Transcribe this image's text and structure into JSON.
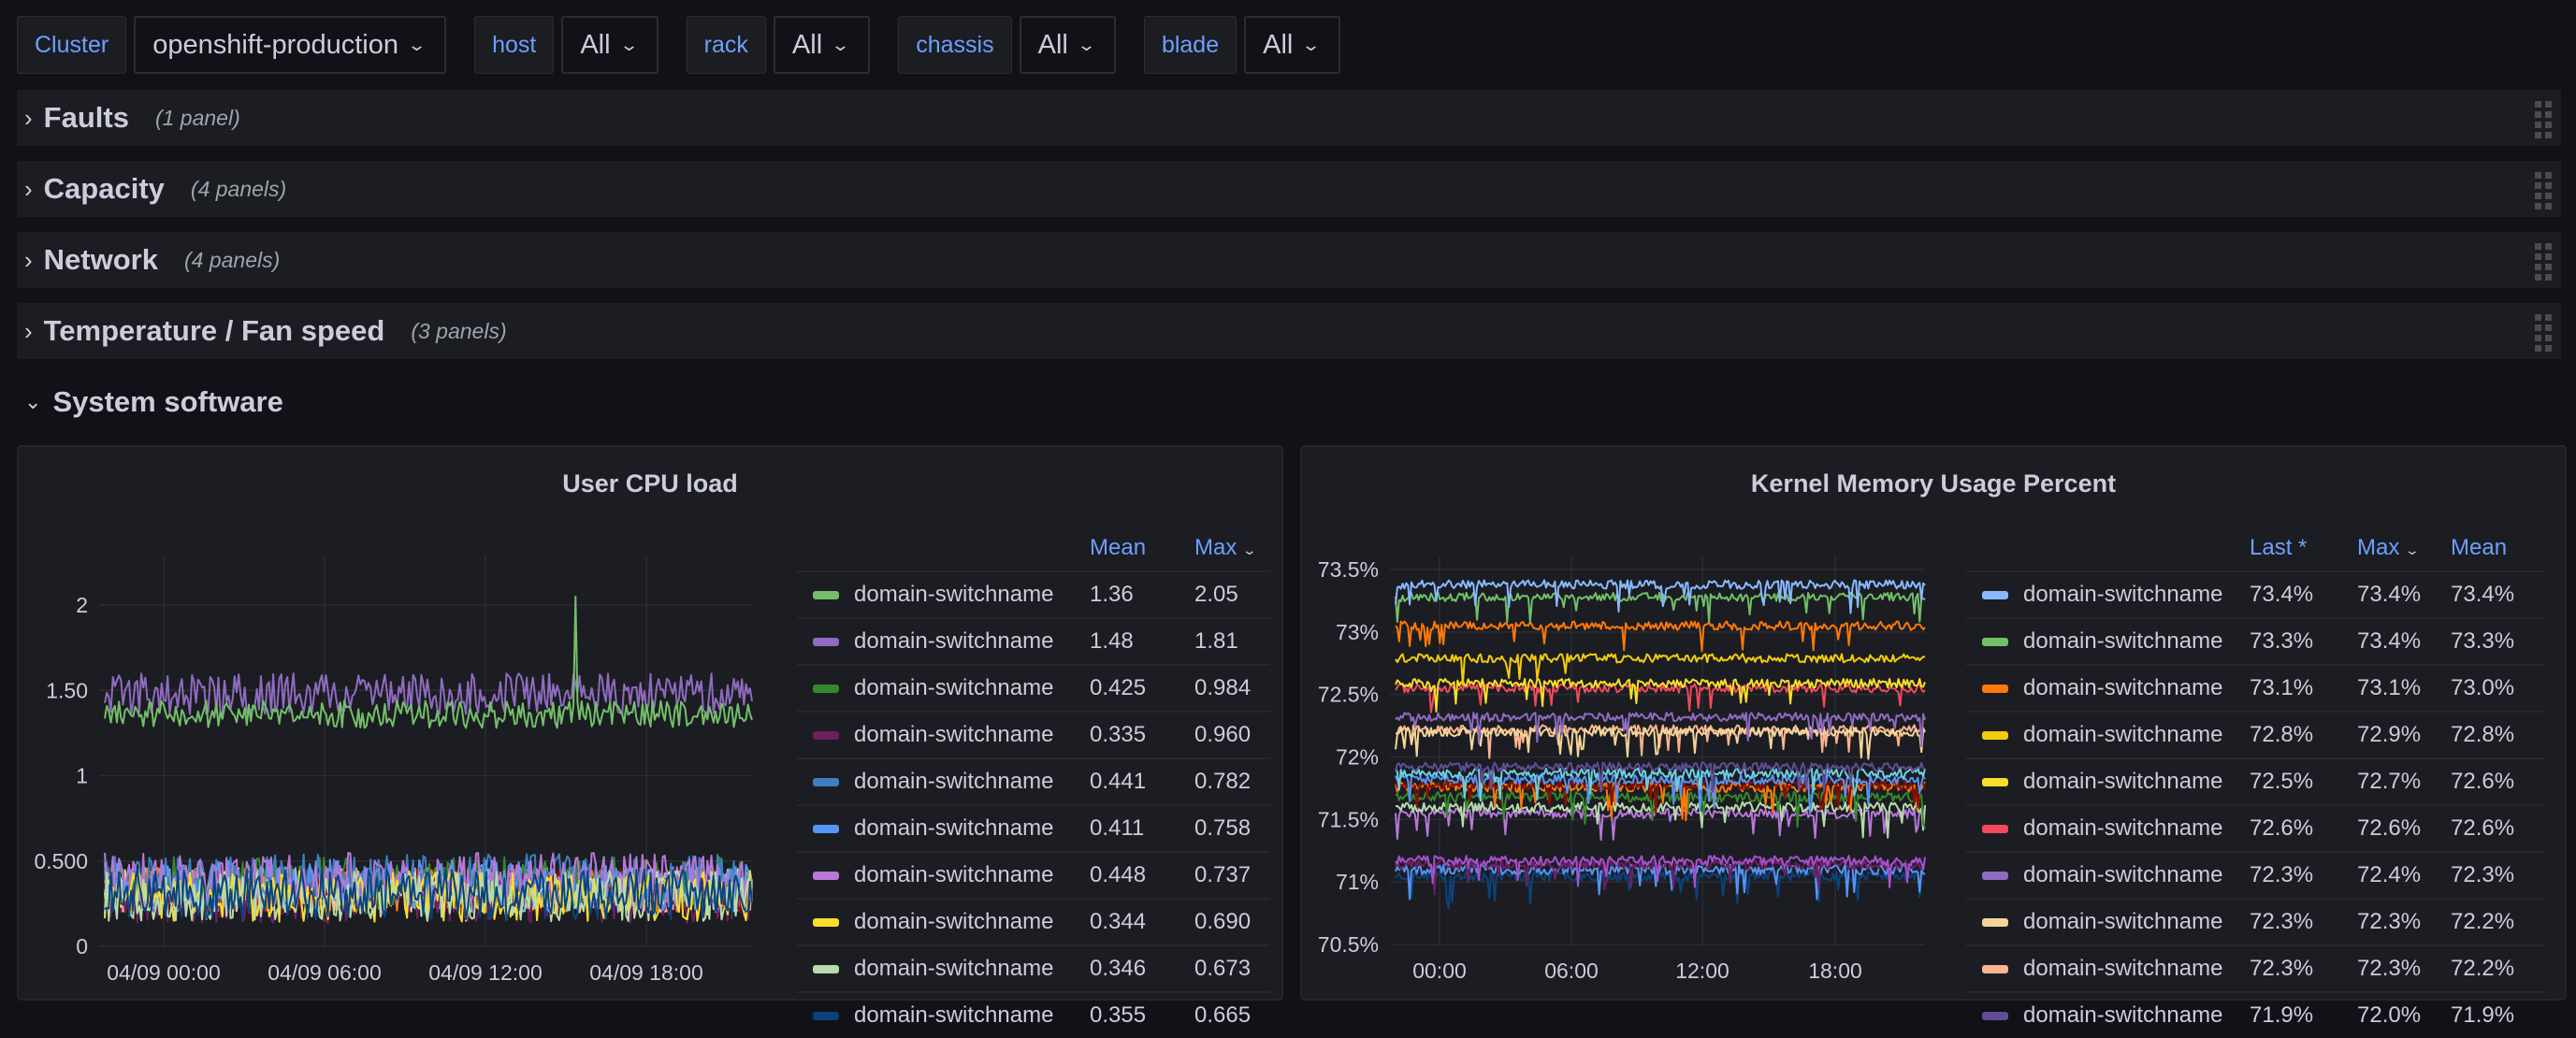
{
  "variables": [
    {
      "label": "Cluster",
      "value": "openshift-production"
    },
    {
      "label": "host",
      "value": "All"
    },
    {
      "label": "rack",
      "value": "All"
    },
    {
      "label": "chassis",
      "value": "All"
    },
    {
      "label": "blade",
      "value": "All"
    }
  ],
  "rows": [
    {
      "title": "Faults",
      "count": "(1 panel)",
      "collapsed": true
    },
    {
      "title": "Capacity",
      "count": "(4 panels)",
      "collapsed": true
    },
    {
      "title": "Network",
      "count": "(4 panels)",
      "collapsed": true
    },
    {
      "title": "Temperature / Fan speed",
      "count": "(3 panels)",
      "collapsed": true
    }
  ],
  "expanded_row": {
    "title": "System software"
  },
  "icons": {
    "expand": "chevron-right-icon",
    "collapse": "chevron-down-icon",
    "drag": "drag-handle-icon"
  },
  "chart_data": [
    {
      "type": "line",
      "title": "User CPU load",
      "xlabel": "",
      "ylabel": "",
      "x_ticks": [
        "04/09 00:00",
        "04/09 06:00",
        "04/09 12:00",
        "04/09 18:00"
      ],
      "y_ticks": [
        "0",
        "0.500",
        "1",
        "1.50",
        "2"
      ],
      "y_tick_values": [
        0,
        0.5,
        1,
        1.5,
        2
      ],
      "ylim": [
        0,
        2.2
      ],
      "grid": true,
      "legend_placement": "right",
      "legend_columns": [
        "Mean",
        "Max"
      ],
      "sort_column": "Max",
      "series": [
        {
          "name": "domain-switchname",
          "color": "#73bf69",
          "mean": "1.36",
          "max": "2.05",
          "mean_v": 1.36,
          "max_v": 2.05
        },
        {
          "name": "domain-switchname",
          "color": "#8f6bbf",
          "mean": "1.48",
          "max": "1.81",
          "mean_v": 1.48,
          "max_v": 1.81
        },
        {
          "name": "domain-switchname",
          "color": "#37872d",
          "mean": "0.425",
          "max": "0.984",
          "mean_v": 0.425,
          "max_v": 0.984
        },
        {
          "name": "domain-switchname",
          "color": "#6d1f62",
          "mean": "0.335",
          "max": "0.960",
          "mean_v": 0.335,
          "max_v": 0.96
        },
        {
          "name": "domain-switchname",
          "color": "#3d7fbf",
          "mean": "0.441",
          "max": "0.782",
          "mean_v": 0.441,
          "max_v": 0.782
        },
        {
          "name": "domain-switchname",
          "color": "#5794f2",
          "mean": "0.411",
          "max": "0.758",
          "mean_v": 0.411,
          "max_v": 0.758
        },
        {
          "name": "domain-switchname",
          "color": "#b877d9",
          "mean": "0.448",
          "max": "0.737",
          "mean_v": 0.448,
          "max_v": 0.737
        },
        {
          "name": "domain-switchname",
          "color": "#fade2a",
          "mean": "0.344",
          "max": "0.690",
          "mean_v": 0.344,
          "max_v": 0.69
        },
        {
          "name": "domain-switchname",
          "color": "#b7dbab",
          "mean": "0.346",
          "max": "0.673",
          "mean_v": 0.346,
          "max_v": 0.673
        },
        {
          "name": "domain-switchname",
          "color": "#0a437c",
          "mean": "0.355",
          "max": "0.665",
          "mean_v": 0.355,
          "max_v": 0.665
        }
      ],
      "extra_series_colors": [
        "#6ed0e0",
        "#ffb357",
        "#ff7383",
        "#fccb93",
        "#8ab8ff",
        "#890f02",
        "#ff780a"
      ]
    },
    {
      "type": "line",
      "title": "Kernel Memory Usage Percent",
      "xlabel": "",
      "ylabel": "",
      "x_ticks": [
        "00:00",
        "06:00",
        "12:00",
        "18:00"
      ],
      "y_ticks": [
        "70.5%",
        "71%",
        "71.5%",
        "72%",
        "72.5%",
        "73%",
        "73.5%"
      ],
      "y_tick_values": [
        70.5,
        71,
        71.5,
        72,
        72.5,
        73,
        73.5
      ],
      "ylim": [
        70.5,
        73.8
      ],
      "grid": true,
      "legend_placement": "right",
      "legend_columns": [
        "Last *",
        "Max",
        "Mean"
      ],
      "sort_column": "Max",
      "series": [
        {
          "name": "domain-switchname",
          "color": "#8ab8ff",
          "last": "73.4%",
          "max": "73.4%",
          "mean": "73.4%",
          "mean_v": 73.38
        },
        {
          "name": "domain-switchname",
          "color": "#73bf69",
          "last": "73.3%",
          "max": "73.4%",
          "mean": "73.3%",
          "mean_v": 73.28
        },
        {
          "name": "domain-switchname",
          "color": "#ff780a",
          "last": "73.1%",
          "max": "73.1%",
          "mean": "73.0%",
          "mean_v": 73.05
        },
        {
          "name": "domain-switchname",
          "color": "#f2cc0c",
          "last": "72.8%",
          "max": "72.9%",
          "mean": "72.8%",
          "mean_v": 72.79
        },
        {
          "name": "domain-switchname",
          "color": "#fade2a",
          "last": "72.5%",
          "max": "72.7%",
          "mean": "72.6%",
          "mean_v": 72.59
        },
        {
          "name": "domain-switchname",
          "color": "#f2495c",
          "last": "72.6%",
          "max": "72.6%",
          "mean": "72.6%",
          "mean_v": 72.55
        },
        {
          "name": "domain-switchname",
          "color": "#8f6bbf",
          "last": "72.3%",
          "max": "72.4%",
          "mean": "72.3%",
          "mean_v": 72.32
        },
        {
          "name": "domain-switchname",
          "color": "#f4d598",
          "last": "72.3%",
          "max": "72.3%",
          "mean": "72.2%",
          "mean_v": 72.2
        },
        {
          "name": "domain-switchname",
          "color": "#fcb48e",
          "last": "72.3%",
          "max": "72.3%",
          "mean": "72.2%",
          "mean_v": 72.22
        },
        {
          "name": "domain-switchname",
          "color": "#614d93",
          "last": "71.9%",
          "max": "72.0%",
          "mean": "71.9%",
          "mean_v": 71.92
        }
      ],
      "extra_series": [
        {
          "color": "#6ed0e0",
          "mean_v": 71.87
        },
        {
          "color": "#5794f2",
          "mean_v": 71.82
        },
        {
          "color": "#890f02",
          "mean_v": 71.78
        },
        {
          "color": "#ff780a",
          "mean_v": 71.76
        },
        {
          "color": "#37872d",
          "mean_v": 71.68
        },
        {
          "color": "#b7dbab",
          "mean_v": 71.6
        },
        {
          "color": "#b877d9",
          "mean_v": 71.55
        },
        {
          "color": "#a352cc",
          "mean_v": 71.17
        },
        {
          "color": "#6d1f62",
          "mean_v": 71.14
        },
        {
          "color": "#5794f2",
          "mean_v": 71.1
        },
        {
          "color": "#0a437c",
          "mean_v": 71.05
        }
      ]
    }
  ]
}
